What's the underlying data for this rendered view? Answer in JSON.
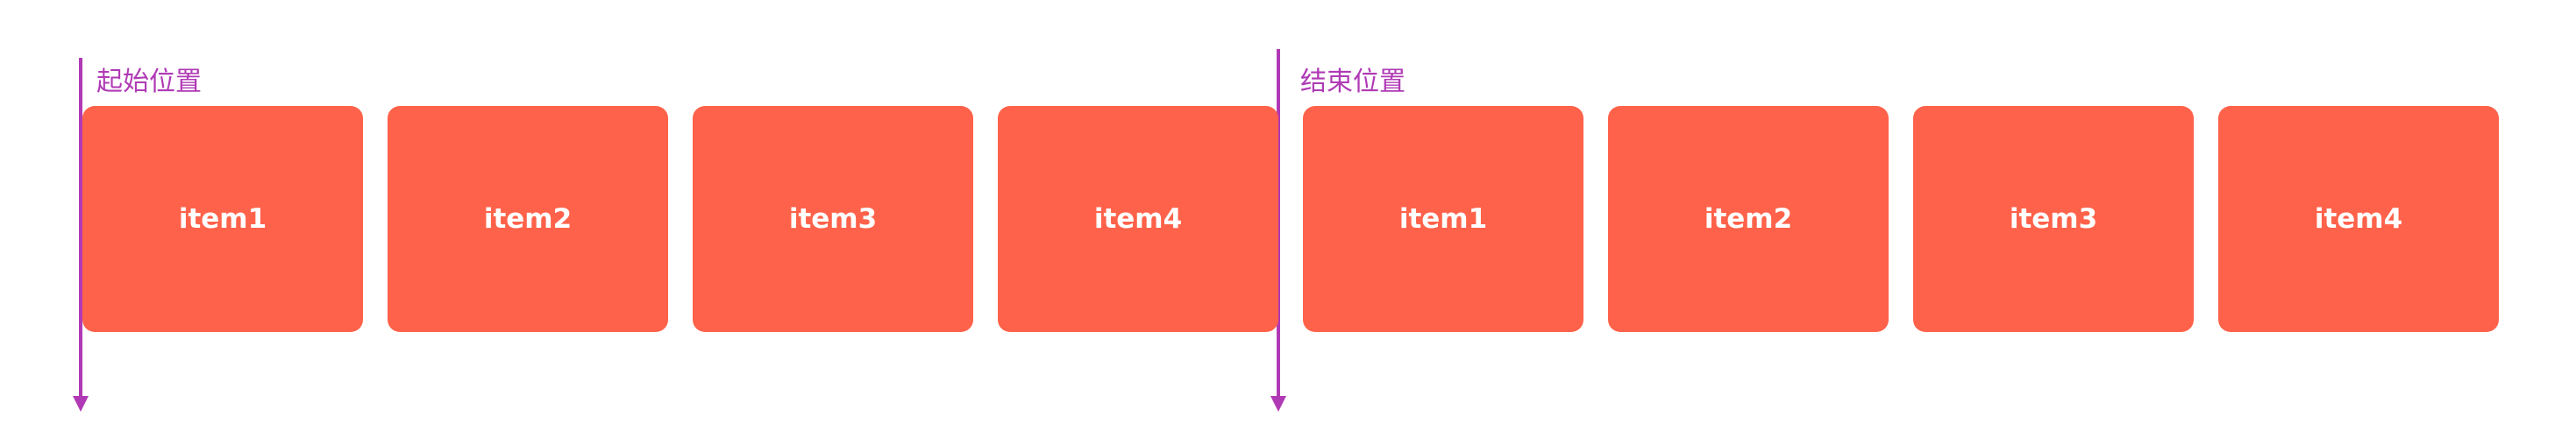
{
  "items": [
    "item1",
    "item2",
    "item3",
    "item4",
    "item1",
    "item2",
    "item3",
    "item4"
  ],
  "markers": {
    "start_label": "起始位置",
    "end_label": "结束位置"
  },
  "colors": {
    "item_fill": "#ff624a",
    "item_text": "#ffffff",
    "marker": "#b03ab5",
    "background": "#ffffff"
  }
}
